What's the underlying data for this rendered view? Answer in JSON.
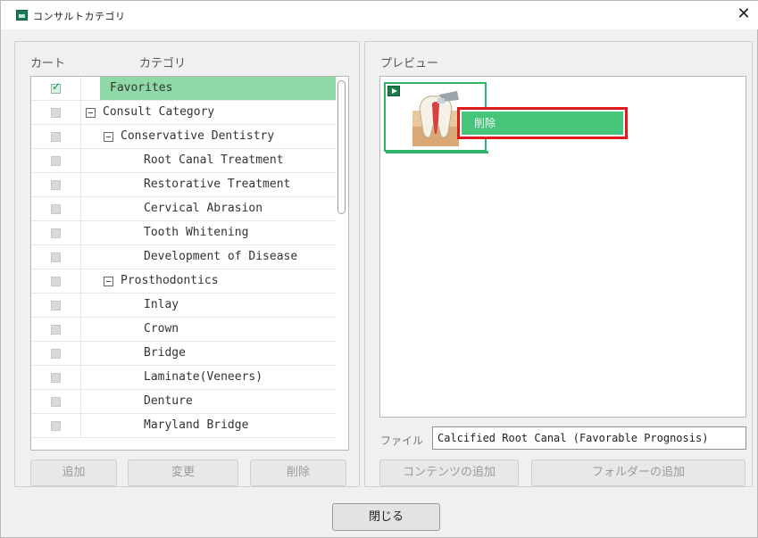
{
  "window": {
    "title": "コンサルトカテゴリ",
    "close_glyph": "✕"
  },
  "left": {
    "header_cart": "カート",
    "header_category": "カテゴリ",
    "rows": [
      {
        "label": "Favorites",
        "checked": true,
        "selected": true,
        "expander": false,
        "level": 0
      },
      {
        "label": "Consult Category",
        "checked": false,
        "expander": true,
        "level": 0
      },
      {
        "label": "Conservative Dentistry",
        "checked": false,
        "expander": true,
        "level": 1
      },
      {
        "label": "Root Canal Treatment",
        "checked": false,
        "expander": false,
        "level": 2
      },
      {
        "label": "Restorative Treatment",
        "checked": false,
        "expander": false,
        "level": 2
      },
      {
        "label": "Cervical Abrasion",
        "checked": false,
        "expander": false,
        "level": 2
      },
      {
        "label": "Tooth Whitening",
        "checked": false,
        "expander": false,
        "level": 2
      },
      {
        "label": "Development of Disease",
        "checked": false,
        "expander": false,
        "level": 2
      },
      {
        "label": "Prosthodontics",
        "checked": false,
        "expander": true,
        "level": 1
      },
      {
        "label": "Inlay",
        "checked": false,
        "expander": false,
        "level": 2
      },
      {
        "label": "Crown",
        "checked": false,
        "expander": false,
        "level": 2
      },
      {
        "label": "Bridge",
        "checked": false,
        "expander": false,
        "level": 2
      },
      {
        "label": "Laminate(Veneers)",
        "checked": false,
        "expander": false,
        "level": 2
      },
      {
        "label": "Denture",
        "checked": false,
        "expander": false,
        "level": 2
      },
      {
        "label": "Maryland Bridge",
        "checked": false,
        "expander": false,
        "level": 2
      }
    ],
    "buttons": {
      "add": "追加",
      "change": "変更",
      "delete": "削除"
    }
  },
  "right": {
    "header_preview": "プレビュー",
    "context_menu_item": "削除",
    "file_label": "ファイル",
    "file_value": "Calcified Root Canal (Favorable Prognosis)",
    "buttons": {
      "add_content": "コンテンツの追加",
      "add_folder": "フォルダーの追加"
    }
  },
  "footer": {
    "close_label": "閉じる"
  },
  "colors": {
    "accent_green": "#2fb36a",
    "selected_row": "#8fd9a8",
    "menu_highlight": "#44c57a",
    "menu_border": "#e01a1a"
  }
}
